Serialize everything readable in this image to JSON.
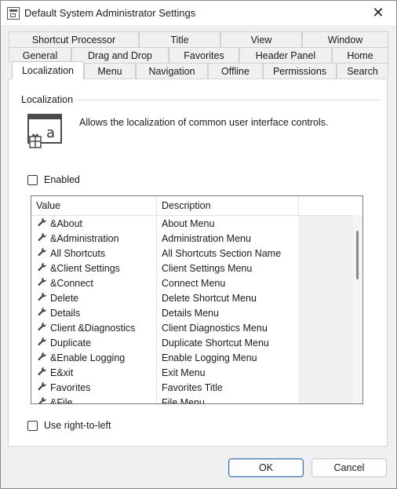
{
  "window": {
    "title": "Default System Administrator Settings",
    "icon": "settings-window-icon",
    "close_glyph": "✕"
  },
  "tabs": {
    "row1": [
      "Shortcut Processor",
      "Title",
      "View",
      "Window"
    ],
    "row2": [
      "General",
      "Drag and Drop",
      "Favorites",
      "Header Panel",
      "Home"
    ],
    "row3": [
      "Localization",
      "Menu",
      "Navigation",
      "Offline",
      "Permissions",
      "Search"
    ],
    "selected": "Localization"
  },
  "panel": {
    "group_title": "Localization",
    "description": "Allows the localization of common user interface controls.",
    "enabled_label": "Enabled",
    "enabled_checked": false,
    "rtl_label": "Use right-to-left",
    "rtl_checked": false,
    "list": {
      "columns": [
        "Value",
        "Description",
        ""
      ],
      "rows": [
        {
          "value": "&About",
          "description": "About Menu"
        },
        {
          "value": "&Administration",
          "description": "Administration Menu"
        },
        {
          "value": "All Shortcuts",
          "description": "All Shortcuts Section Name"
        },
        {
          "value": "&Client Settings",
          "description": "Client Settings Menu"
        },
        {
          "value": "&Connect",
          "description": "Connect Menu"
        },
        {
          "value": "Delete",
          "description": "Delete Shortcut Menu"
        },
        {
          "value": "Details",
          "description": "Details Menu"
        },
        {
          "value": "Client &Diagnostics",
          "description": "Client Diagnostics Menu"
        },
        {
          "value": "Duplicate",
          "description": "Duplicate Shortcut Menu"
        },
        {
          "value": "&Enable Logging",
          "description": "Enable Logging Menu"
        },
        {
          "value": "E&xit",
          "description": "Exit Menu"
        },
        {
          "value": "Favorites",
          "description": "Favorites Title"
        },
        {
          "value": "&File",
          "description": "File Menu"
        }
      ]
    }
  },
  "buttons": {
    "ok": "OK",
    "cancel": "Cancel"
  }
}
